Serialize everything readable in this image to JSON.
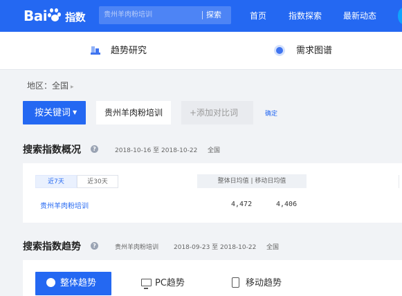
{
  "brand": {
    "logo_left": "Bai",
    "logo_right": "指数"
  },
  "search": {
    "placeholder": "贵州羊肉粉培训",
    "button_label": "探索"
  },
  "nav": {
    "items": [
      "首页",
      "指数探索",
      "最新动态"
    ]
  },
  "subnav": {
    "trend": "趋势研究",
    "demand": "需求图谱"
  },
  "region": {
    "label": "地区：全国"
  },
  "keyword": {
    "mode_button": "按关键词",
    "current_keyword": "贵州羊肉粉培训",
    "add_compare": "+添加对比词",
    "confirm": "确定"
  },
  "overview": {
    "title": "搜索指数概况",
    "date_range": "2018-10-16 至 2018-10-22",
    "region": "全国",
    "tabs": [
      "近7天",
      "近30天"
    ],
    "columns_header": "整体日均值 | 移动日均值",
    "rows": [
      {
        "keyword": "贵州羊肉粉培训",
        "overall_avg": "4,472",
        "mobile_avg": "4,406"
      }
    ]
  },
  "trend": {
    "title": "搜索指数趋势",
    "keyword": "贵州羊肉粉培训",
    "date_range": "2018-09-23 至 2018-10-22",
    "region": "全国",
    "buttons": [
      "整体趋势",
      "PC趋势",
      "移动趋势"
    ]
  },
  "colors": {
    "primary": "#2468f2",
    "link": "#2468f2",
    "page_bg": "#f1f3f6"
  }
}
